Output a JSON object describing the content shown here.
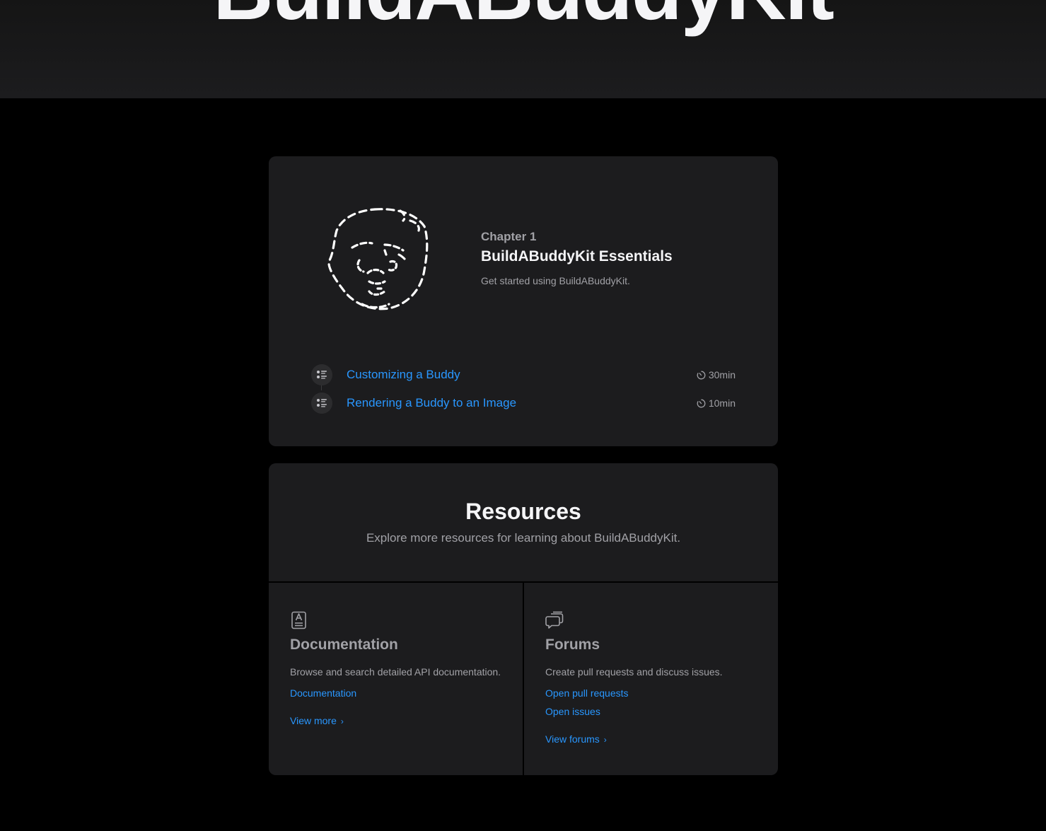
{
  "hero": {
    "title": "BuildABuddyKit"
  },
  "chapter": {
    "eyebrow": "Chapter 1",
    "title": "BuildABuddyKit Essentials",
    "description": "Get started using BuildABuddyKit.",
    "art_icon": "dashed-buddy-face-illustration",
    "tutorials": [
      {
        "label": "Customizing a Buddy",
        "duration": "30min",
        "icon": "tutorial-list-icon"
      },
      {
        "label": "Rendering a Buddy to an Image",
        "duration": "10min",
        "icon": "tutorial-list-icon"
      }
    ]
  },
  "resources": {
    "title": "Resources",
    "subtitle": "Explore more resources for learning about BuildABuddyKit.",
    "documentation": {
      "icon": "documentation-icon",
      "title": "Documentation",
      "description": "Browse and search detailed API documentation.",
      "link": "Documentation",
      "more": "View more"
    },
    "forums": {
      "icon": "forums-icon",
      "title": "Forums",
      "description": "Create pull requests and discuss issues.",
      "link1": "Open pull requests",
      "link2": "Open issues",
      "more": "View forums"
    }
  },
  "colors": {
    "link": "#2997ff",
    "card": "#1c1c1e",
    "secondary_text": "#a1a1a6",
    "page_bg": "#000000"
  }
}
